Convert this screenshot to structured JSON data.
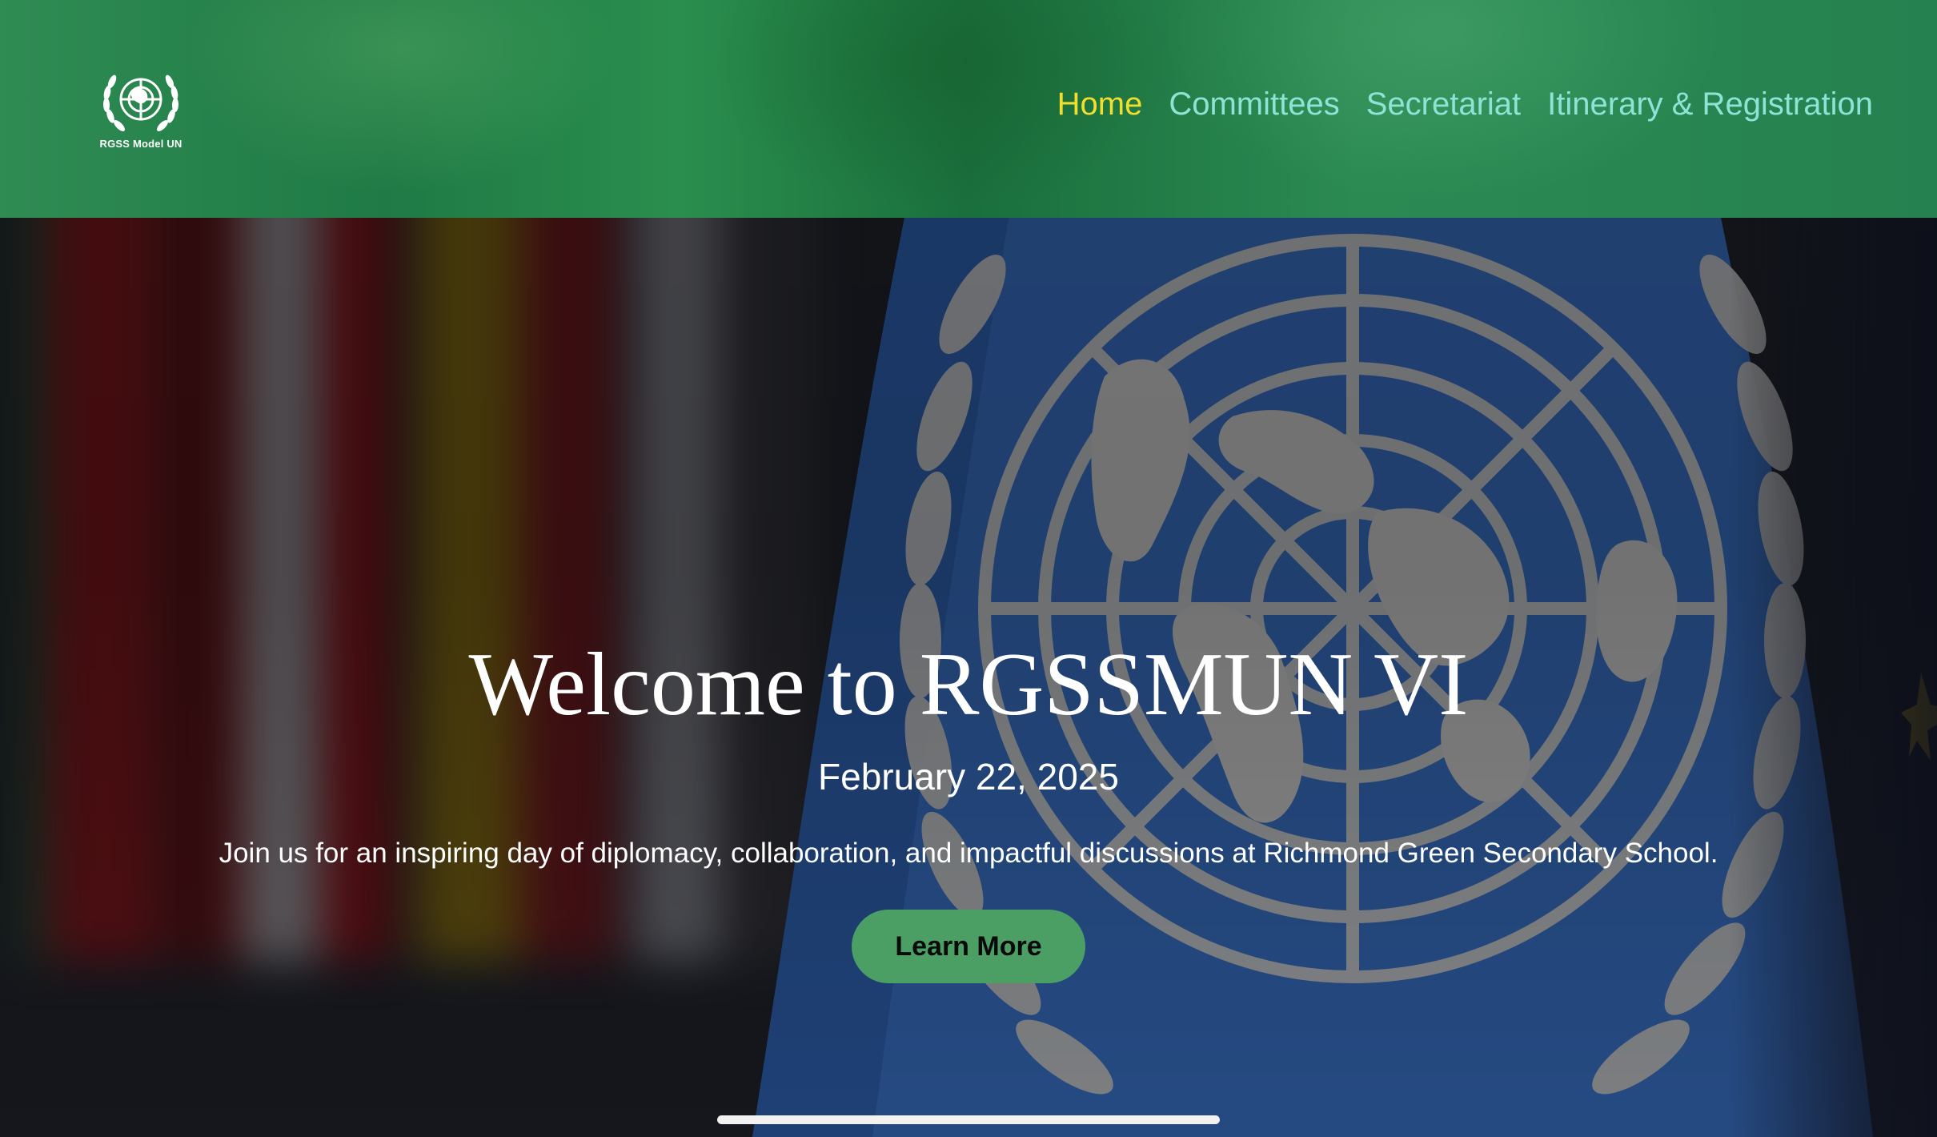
{
  "header": {
    "logo_text": "RGSS Model UN",
    "logo_icon": "un-emblem-icon",
    "nav": [
      {
        "label": "Home",
        "active": true
      },
      {
        "label": "Committees",
        "active": false
      },
      {
        "label": "Secretariat",
        "active": false
      },
      {
        "label": "Itinerary & Registration",
        "active": false
      }
    ]
  },
  "hero": {
    "title": "Welcome to RGSSMUN VI",
    "date": "February 22, 2025",
    "description": "Join us for an inspiring day of diplomacy, collaboration, and impactful discussions at Richmond Green Secondary School.",
    "cta_label": "Learn More",
    "background": "un-flag-image"
  },
  "colors": {
    "header_green": "#2a8a4e",
    "nav_link": "#8fe3d6",
    "nav_active": "#f2de2c",
    "cta_background": "#4b9f65",
    "un_blue": "#2d5fa8"
  }
}
